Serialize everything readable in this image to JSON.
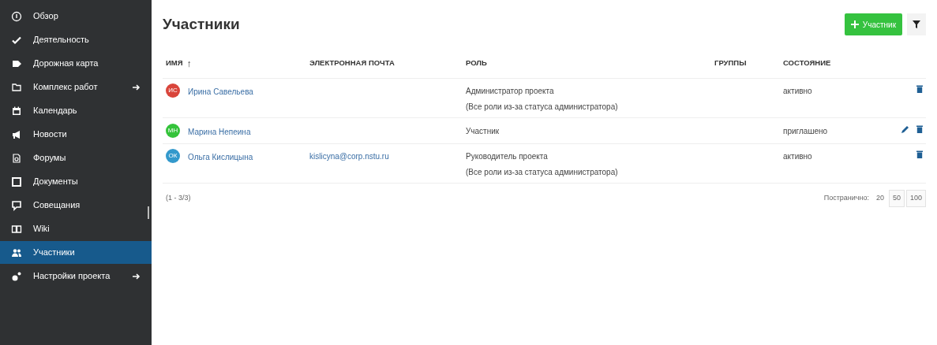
{
  "sidebar": {
    "items": [
      {
        "label": "Обзор",
        "selected": false,
        "arrow": false
      },
      {
        "label": "Деятельность",
        "selected": false,
        "arrow": false
      },
      {
        "label": "Дорожная карта",
        "selected": false,
        "arrow": false
      },
      {
        "label": "Комплекс работ",
        "selected": false,
        "arrow": true
      },
      {
        "label": "Календарь",
        "selected": false,
        "arrow": false
      },
      {
        "label": "Новости",
        "selected": false,
        "arrow": false
      },
      {
        "label": "Форумы",
        "selected": false,
        "arrow": false
      },
      {
        "label": "Документы",
        "selected": false,
        "arrow": false
      },
      {
        "label": "Совещания",
        "selected": false,
        "arrow": false
      },
      {
        "label": "Wiki",
        "selected": false,
        "arrow": false
      },
      {
        "label": "Участники",
        "selected": true,
        "arrow": false
      },
      {
        "label": "Настройки проекта",
        "selected": false,
        "arrow": true
      }
    ]
  },
  "title": "Участники",
  "add_button": "Участник",
  "table": {
    "columns": [
      "ИМЯ",
      "ЭЛЕКТРОННАЯ ПОЧТА",
      "РОЛЬ",
      "ГРУППЫ",
      "СОСТОЯНИЕ"
    ],
    "sort_mark": "↑",
    "rows": [
      {
        "initials": "ИС",
        "color": "#d9453b",
        "name": "Ирина Савельева",
        "email": "",
        "role": [
          "Администратор проекта",
          "(Все роли из-за статуса администратора)"
        ],
        "status": "активно",
        "editable": false
      },
      {
        "initials": "МН",
        "color": "#34c33a",
        "name": "Марина Непеина",
        "email": "",
        "role": [
          "Участник"
        ],
        "status": "приглашено",
        "editable": true
      },
      {
        "initials": "ОК",
        "color": "#3399cc",
        "name": "Ольга Кислицына",
        "email": "kislicyna@corp.nstu.ru",
        "role": [
          "Руководитель проекта",
          "(Все роли из-за статуса администратора)"
        ],
        "status": "активно",
        "editable": false
      }
    ]
  },
  "count": "(1 - 3/3)",
  "per_page": {
    "label": "Постранично:",
    "options": [
      {
        "label": "20",
        "selected": true
      },
      {
        "label": "50",
        "selected": false
      },
      {
        "label": "100",
        "selected": false
      }
    ]
  }
}
